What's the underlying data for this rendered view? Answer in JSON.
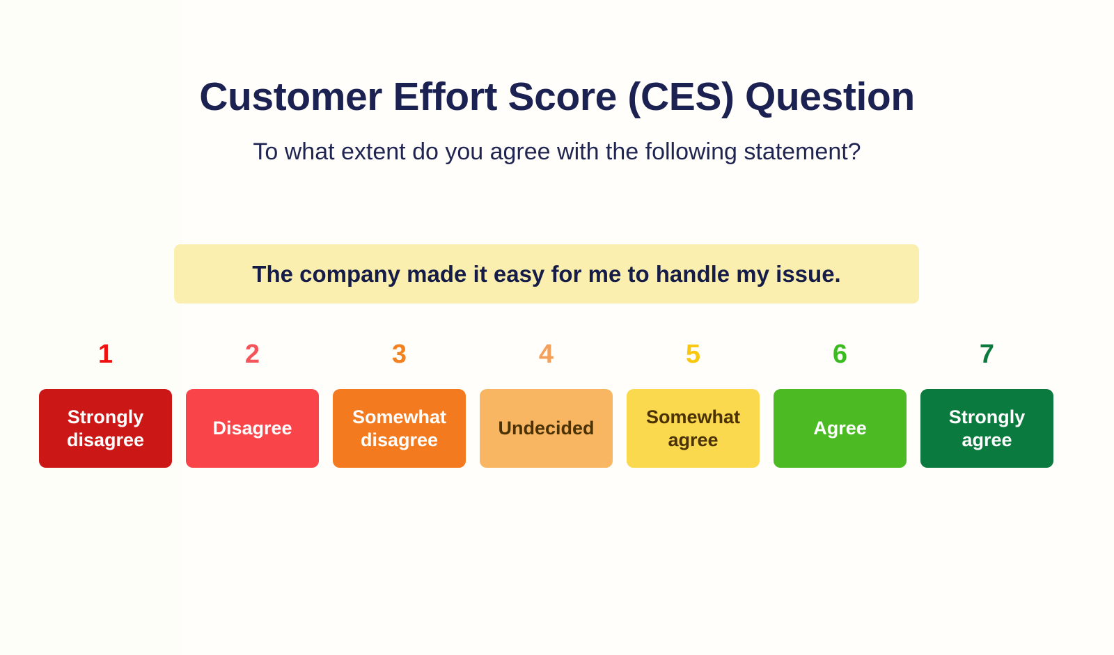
{
  "background_color": "#FEFEF8",
  "header": {
    "title": "Customer Effort Score (CES) Question",
    "subtitle": "To what extent do you agree with the following statement?",
    "title_color": "#1B2150",
    "subtitle_color": "#1F2550"
  },
  "statement": {
    "text": "The company made it easy for me to handle my issue.",
    "background_color": "#FBEFAF",
    "text_color": "#151C47"
  },
  "scale": {
    "min": 1,
    "max": 7,
    "options": [
      {
        "number": "1",
        "label": "Strongly disagree",
        "number_color": "#EE1111",
        "card_color": "#CC1717",
        "label_color": "#FFFFFF"
      },
      {
        "number": "2",
        "label": "Disagree",
        "number_color": "#F4555A",
        "card_color": "#F9454A",
        "label_color": "#FFFFFF"
      },
      {
        "number": "3",
        "label": "Somewhat disagree",
        "number_color": "#F4811F",
        "card_color": "#F47A20",
        "label_color": "#FFFFFF"
      },
      {
        "number": "4",
        "label": "Undecided",
        "number_color": "#F5A05A",
        "card_color": "#F8B562",
        "label_color": "#4A3205"
      },
      {
        "number": "5",
        "label": "Somewhat agree",
        "number_color": "#F9C80E",
        "card_color": "#FAD94E",
        "label_color": "#4A3205"
      },
      {
        "number": "6",
        "label": "Agree",
        "number_color": "#3BBB21",
        "card_color": "#4CBB23",
        "label_color": "#FFFFFF"
      },
      {
        "number": "7",
        "label": "Strongly agree",
        "number_color": "#0B7A3E",
        "card_color": "#0B7A3E",
        "label_color": "#FFFFFF"
      }
    ]
  }
}
